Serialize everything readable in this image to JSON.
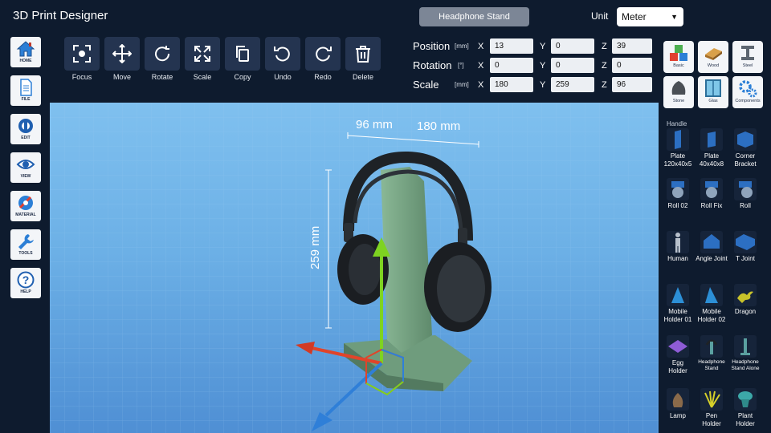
{
  "app": {
    "title": "3D Print Designer",
    "project": "Headphone Stand",
    "unit_label": "Unit",
    "unit_value": "Meter"
  },
  "sidebar": [
    {
      "label": "HOME",
      "icon": "home-icon"
    },
    {
      "label": "FILE",
      "icon": "file-icon"
    },
    {
      "label": "EDIT",
      "icon": "edit-icon"
    },
    {
      "label": "VIEW",
      "icon": "eye-icon"
    },
    {
      "label": "MATERIAL",
      "icon": "material-icon"
    },
    {
      "label": "TOOLS",
      "icon": "wrench-icon"
    },
    {
      "label": "HELP",
      "icon": "help-icon"
    }
  ],
  "toolbar": [
    {
      "label": "Focus",
      "icon": "focus-icon"
    },
    {
      "label": "Move",
      "icon": "move-icon"
    },
    {
      "label": "Rotate",
      "icon": "rotate-icon"
    },
    {
      "label": "Scale",
      "icon": "scale-icon"
    },
    {
      "label": "Copy",
      "icon": "copy-icon"
    },
    {
      "label": "Undo",
      "icon": "undo-icon"
    },
    {
      "label": "Redo",
      "icon": "redo-icon"
    },
    {
      "label": "Delete",
      "icon": "trash-icon"
    }
  ],
  "transform": {
    "axes": [
      "X",
      "Y",
      "Z"
    ],
    "position": {
      "label": "Position",
      "unit": "[mm]",
      "x": "13",
      "y": "0",
      "z": "39"
    },
    "rotation": {
      "label": "Rotation",
      "unit": "[°]",
      "x": "0",
      "y": "0",
      "z": "0"
    },
    "scale": {
      "label": "Scale",
      "unit": "[mm]",
      "x": "180",
      "y": "259",
      "z": "96"
    }
  },
  "viewport": {
    "dim_depth": "96 mm",
    "dim_width": "180 mm",
    "dim_height": "259 mm"
  },
  "materials": [
    {
      "label": "Basic",
      "icon": "cubes-icon"
    },
    {
      "label": "Wood",
      "icon": "wood-icon"
    },
    {
      "label": "Steel",
      "icon": "steel-beam-icon"
    },
    {
      "label": "Stone",
      "icon": "stone-icon"
    },
    {
      "label": "Glas",
      "icon": "glass-icon"
    },
    {
      "label": "Components",
      "icon": "gears-icon"
    }
  ],
  "palette": {
    "heading": "Handle",
    "items": [
      {
        "label": "Plate 120x40x5"
      },
      {
        "label": "Plate 40x40x8"
      },
      {
        "label": "Corner Bracket"
      },
      {
        "label": "Roll 02"
      },
      {
        "label": "Roll Fix"
      },
      {
        "label": "Roll"
      },
      {
        "label": "Human"
      },
      {
        "label": "Angle Joint"
      },
      {
        "label": "T Joint"
      },
      {
        "label": "Mobile Holder 01"
      },
      {
        "label": "Mobile Holder 02"
      },
      {
        "label": "Dragon"
      },
      {
        "label": "Egg Holder"
      },
      {
        "label": "Headphone Stand"
      },
      {
        "label": "Headphone Stand Alone"
      },
      {
        "label": "Lamp"
      },
      {
        "label": "Pen Holder"
      },
      {
        "label": "Plant Holder"
      }
    ]
  },
  "colors": {
    "background": "#0e1b2e",
    "tool_button": "#243450",
    "stand": "#7fa98a",
    "headphones": "#1e2226",
    "axis_x": "#e0442a",
    "axis_y": "#7ed321",
    "axis_z": "#2f7fd8"
  }
}
